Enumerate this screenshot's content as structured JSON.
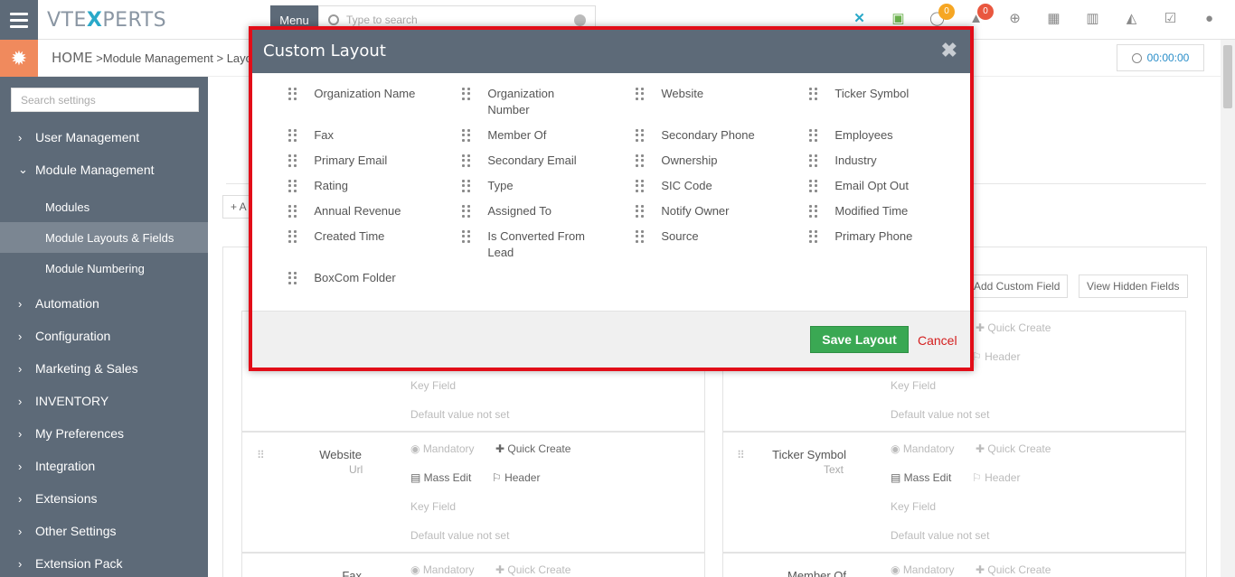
{
  "topbar": {
    "logo_pre": "VTE",
    "logo_x": "X",
    "logo_post": "PERTS",
    "menu_label": "Menu",
    "search_placeholder": "Type to search",
    "notif_badge_1": "0",
    "notif_badge_2": "0"
  },
  "breadcrumb": {
    "home": "HOME",
    "sep1": " >",
    "item1": "Module Management",
    "sep2": " > ",
    "item2": "Layout"
  },
  "timer": "00:00:00",
  "sidebar": {
    "search_placeholder": "Search settings",
    "items": [
      {
        "label": "User Management",
        "chev": "›"
      },
      {
        "label": "Module Management",
        "chev": "⌄"
      },
      {
        "label": "Automation",
        "chev": "›"
      },
      {
        "label": "Configuration",
        "chev": "›"
      },
      {
        "label": "Marketing & Sales",
        "chev": "›"
      },
      {
        "label": "INVENTORY",
        "chev": "›"
      },
      {
        "label": "My Preferences",
        "chev": "›"
      },
      {
        "label": "Integration",
        "chev": "›"
      },
      {
        "label": "Extensions",
        "chev": "›"
      },
      {
        "label": "Other Settings",
        "chev": "›"
      },
      {
        "label": "Extension Pack",
        "chev": "›"
      }
    ],
    "subitems": [
      {
        "label": "Modules"
      },
      {
        "label": "Module Layouts & Fields"
      },
      {
        "label": "Module Numbering"
      }
    ]
  },
  "background": {
    "add_btn": "+ A",
    "add_custom_field": "Add Custom Field",
    "view_hidden_fields": "View Hidden Fields",
    "website_label": "Website",
    "website_type": "Url",
    "ticker_label": "Ticker Symbol",
    "ticker_type": "Text",
    "fax_label": "Fax",
    "member_label": "Member Of",
    "mandatory": "Mandatory",
    "quick_create": "Quick Create",
    "mass_edit": "Mass Edit",
    "header": "Header",
    "key_field": "Key Field",
    "default_value": "Default value not set"
  },
  "modal": {
    "title": "Custom Layout",
    "close": "✖",
    "fields": [
      "Organization Name",
      "Organization Number",
      "Website",
      "Ticker Symbol",
      "Fax",
      "Member Of",
      "Secondary Phone",
      "Employees",
      "Primary Email",
      "Secondary Email",
      "Ownership",
      "Industry",
      "Rating",
      "Type",
      "SIC Code",
      "Email Opt Out",
      "Annual Revenue",
      "Assigned To",
      "Notify Owner",
      "Modified Time",
      "Created Time",
      "Is Converted From Lead",
      "Source",
      "Primary Phone",
      "BoxCom Folder"
    ],
    "save_label": "Save Layout",
    "cancel_label": "Cancel"
  },
  "colors": {
    "accent": "#5d6a78",
    "highlight_frame": "#e20d18",
    "save_green": "#3aa853",
    "cancel_red": "#d41e1e"
  }
}
